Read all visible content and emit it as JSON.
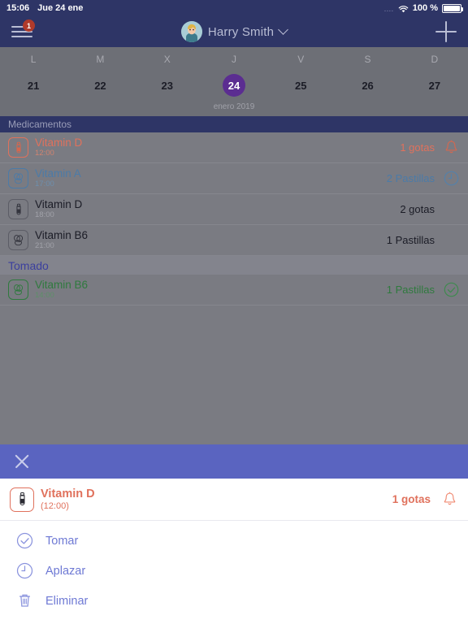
{
  "statusbar": {
    "time": "15:06",
    "date": "Jue 24 ene",
    "signal_dots": "....",
    "wifi_icon": "wifi-icon",
    "battery_percent": "100 %",
    "battery_icon": "battery-full-icon"
  },
  "navbar": {
    "menu_icon": "hamburger-menu-icon",
    "menu_badge": "1",
    "avatar_icon": "user-avatar",
    "user_name": "Harry Smith",
    "dropdown_icon": "chevron-down-icon",
    "add_icon": "plus-icon"
  },
  "calendar": {
    "days_of_week": [
      "L",
      "M",
      "X",
      "J",
      "V",
      "S",
      "D"
    ],
    "dates": [
      "21",
      "22",
      "23",
      "24",
      "25",
      "26",
      "27"
    ],
    "selected_index": 3,
    "month_label": "enero 2019",
    "selected_color": "#5b2d91"
  },
  "list": {
    "sections": [
      {
        "title": "Medicamentos",
        "style": "primary",
        "items": [
          {
            "name": "Vitamin D",
            "time": "12:00",
            "quantity": "1 gotas",
            "icon": "drops-bottle-icon",
            "action_icon": "bell-icon",
            "color": "orange"
          },
          {
            "name": "Vitamin A",
            "time": "17:00",
            "quantity": "2 Pastillas",
            "icon": "pills-icon",
            "action_icon": "clock-icon",
            "color": "blue"
          },
          {
            "name": "Vitamin D",
            "time": "18:00",
            "quantity": "2 gotas",
            "icon": "drops-bottle-icon",
            "action_icon": "none",
            "color": "dark"
          },
          {
            "name": "Vitamin B6",
            "time": "21:00",
            "quantity": "1 Pastillas",
            "icon": "pills-icon",
            "action_icon": "none",
            "color": "dark"
          }
        ]
      },
      {
        "title": "Tomado",
        "style": "tomado",
        "items": [
          {
            "name": "Vitamin B6",
            "time": "14:00",
            "quantity": "1 Pastillas",
            "icon": "pills-icon",
            "action_icon": "check-circle-icon",
            "color": "green"
          }
        ]
      }
    ]
  },
  "sheet": {
    "close_icon": "close-icon",
    "header_color": "#5a64c0",
    "medication": {
      "name": "Vitamin D",
      "time": "(12:00)",
      "quantity": "1 gotas",
      "icon": "drops-bottle-icon",
      "action_icon": "bell-icon",
      "color": "orange"
    },
    "actions": [
      {
        "label": "Tomar",
        "icon": "check-circle-icon"
      },
      {
        "label": "Aplazar",
        "icon": "clock-icon"
      },
      {
        "label": "Eliminar",
        "icon": "trash-icon"
      }
    ]
  }
}
